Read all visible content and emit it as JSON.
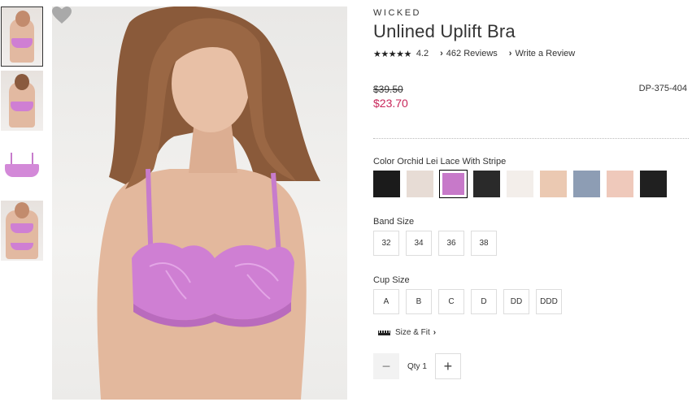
{
  "product": {
    "brand": "WICKED",
    "title": "Unlined Uplift Bra",
    "stars_display": "★★★★★",
    "rating": "4.2",
    "reviews_link": "462 Reviews",
    "write_review_link": "Write a Review",
    "old_price": "$39.50",
    "sale_price": "$23.70",
    "sku": "DP-375-404"
  },
  "color": {
    "label": "Color Orchid Lei Lace With Stripe",
    "swatches": [
      {
        "name": "black-lace",
        "color": "#1b1b1b"
      },
      {
        "name": "ivory-lace",
        "color": "#e7dcd5"
      },
      {
        "name": "orchid-lei-lace-with-stripe",
        "color": "#c779c9",
        "selected": true
      },
      {
        "name": "black-floral-lace",
        "color": "#2a2a2a"
      },
      {
        "name": "white-lace",
        "color": "#f3eeea"
      },
      {
        "name": "nude-lace",
        "color": "#ebc9b2"
      },
      {
        "name": "blue-grey-lace",
        "color": "#8d9db4"
      },
      {
        "name": "blush",
        "color": "#efc9bb"
      },
      {
        "name": "black",
        "color": "#202020"
      }
    ]
  },
  "band_size": {
    "label": "Band Size",
    "options": [
      "32",
      "34",
      "36",
      "38"
    ]
  },
  "cup_size": {
    "label": "Cup Size",
    "options": [
      "A",
      "B",
      "C",
      "D",
      "DD",
      "DDD"
    ]
  },
  "size_fit": {
    "label": "Size & Fit",
    "icon": "ruler-icon"
  },
  "quantity": {
    "label": "Qty",
    "value": "1",
    "minus": "−",
    "plus": "+"
  },
  "icons": {
    "heart": "heart-icon",
    "chevron": "chevron-right-icon"
  }
}
